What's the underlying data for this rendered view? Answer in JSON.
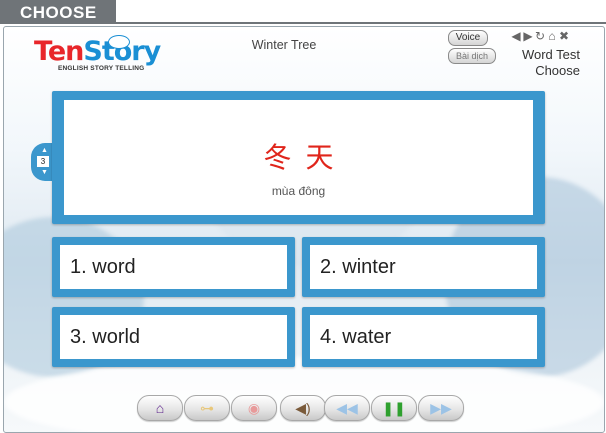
{
  "header": {
    "tag": "CHOOSE"
  },
  "logo": {
    "ten": "Ten",
    "story": "Story",
    "subtitle": "ENGLISH STORY TELLING"
  },
  "story_title": "Winter Tree",
  "controls": {
    "voice": "Voice",
    "bai_dich": "Bài dịch",
    "mini": [
      "◀",
      "▶",
      "↻",
      "⌂",
      "✖"
    ]
  },
  "mode": {
    "line1": "Word Test",
    "line2": "Choose"
  },
  "question": {
    "number": "3",
    "word": "冬天",
    "pronunciation": "mùa đông"
  },
  "answers": [
    {
      "number": "1.",
      "text": "word"
    },
    {
      "number": "2.",
      "text": "winter"
    },
    {
      "number": "3.",
      "text": "world"
    },
    {
      "number": "4.",
      "text": "water"
    }
  ],
  "toolbar": {
    "home": "⌂",
    "key": "⊶",
    "record": "◉",
    "volume": "◀)",
    "prev": "◀◀",
    "pause": "❚❚",
    "next": "▶▶"
  },
  "colors": {
    "accent": "#3b97cd",
    "question_text": "#e0251b",
    "tag_bg": "#6f7478"
  }
}
